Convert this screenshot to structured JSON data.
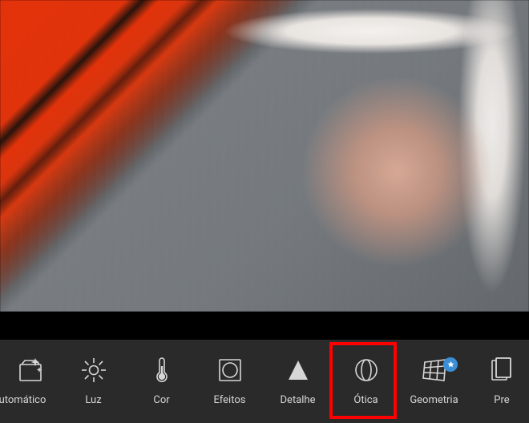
{
  "toolbar": {
    "items": [
      {
        "id": "automatic",
        "label": "utomático",
        "icon": "auto-wand-icon"
      },
      {
        "id": "light",
        "label": "Luz",
        "icon": "sun-icon"
      },
      {
        "id": "color",
        "label": "Cor",
        "icon": "thermometer-icon"
      },
      {
        "id": "effects",
        "label": "Efeitos",
        "icon": "vignette-icon"
      },
      {
        "id": "detail",
        "label": "Detalhe",
        "icon": "triangle-icon",
        "highlighted": true
      },
      {
        "id": "optics",
        "label": "Ótica",
        "icon": "lens-icon"
      },
      {
        "id": "geometry",
        "label": "Geometria",
        "icon": "geometry-grid-icon",
        "badge": "star"
      },
      {
        "id": "presets",
        "label": "Pre",
        "icon": "presets-icon"
      }
    ]
  },
  "colors": {
    "highlight": "#ff0000",
    "toolbar_bg": "#2a2a2a",
    "icon": "#d6d6d6",
    "badge": "#3b8fd6"
  }
}
